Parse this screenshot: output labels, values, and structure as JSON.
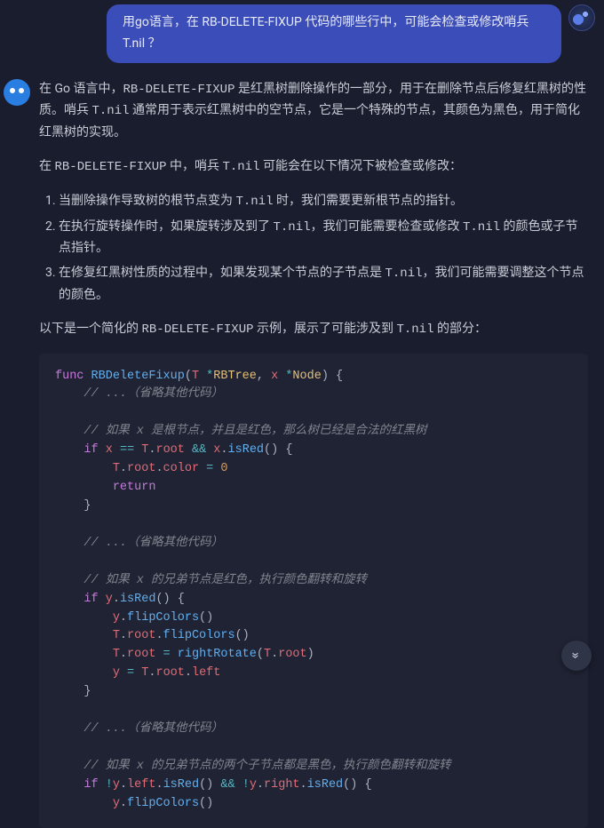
{
  "user": {
    "message": "用go语言，在 RB-DELETE-FIXUP 代码的哪些行中，可能会检查或修改哨兵 T.nil ？"
  },
  "assistant": {
    "para1_a": "在 Go 语言中，",
    "para1_code1": "RB-DELETE-FIXUP",
    "para1_b": " 是红黑树删除操作的一部分，用于在删除节点后修复红黑树的性质。哨兵 ",
    "para1_code2": "T.nil",
    "para1_c": " 通常用于表示红黑树中的空节点，它是一个特殊的节点，其颜色为黑色，用于简化红黑树的实现。",
    "para2_a": "在 ",
    "para2_code1": "RB-DELETE-FIXUP",
    "para2_b": " 中，哨兵 ",
    "para2_code2": "T.nil",
    "para2_c": " 可能会在以下情况下被检查或修改：",
    "list": {
      "li1_a": "当删除操作导致树的根节点变为 ",
      "li1_code": "T.nil",
      "li1_b": " 时，我们需要更新根节点的指针。",
      "li2_a": "在执行旋转操作时，如果旋转涉及到了 ",
      "li2_code1": "T.nil",
      "li2_b": "，我们可能需要检查或修改 ",
      "li2_code2": "T.nil",
      "li2_c": " 的颜色或子节点指针。",
      "li3_a": "在修复红黑树性质的过程中，如果发现某个节点的子节点是 ",
      "li3_code": "T.nil",
      "li3_b": "，我们可能需要调整这个节点的颜色。"
    },
    "para3_a": "以下是一个简化的 ",
    "para3_code1": "RB-DELETE-FIXUP",
    "para3_b": " 示例，展示了可能涉及到 ",
    "para3_code2": "T.nil",
    "para3_c": " 的部分："
  },
  "code": {
    "kw_func": "func",
    "fn_name": "RBDeleteFixup",
    "ty_rbtree": "RBTree",
    "ty_node": "Node",
    "cm_omit1": "// ...（省略其他代码）",
    "cm_root_red": "// 如果 x 是根节点，并且是红色，那么树已经是合法的红黑树",
    "kw_if": "if",
    "id_x": "x",
    "id_T": "T",
    "id_root": "root",
    "fn_isRed": "isRed",
    "id_color": "color",
    "nm_zero": "0",
    "kw_return": "return",
    "cm_omit2": "// ...（省略其他代码）",
    "cm_sibling_red": "// 如果 x 的兄弟节点是红色，执行颜色翻转和旋转",
    "id_y": "y",
    "fn_flipColors": "flipColors",
    "fn_rightRotate": "rightRotate",
    "id_left": "left",
    "cm_omit3": "// ...（省略其他代码）",
    "cm_both_black": "// 如果 x 的兄弟节点的两个子节点都是黑色，执行颜色翻转和旋转",
    "id_right": "right",
    "op_eq": "==",
    "op_and": "&&",
    "op_not": "!",
    "op_star": "*",
    "op_assign": "="
  },
  "icons": {
    "scroll_down": "»"
  }
}
